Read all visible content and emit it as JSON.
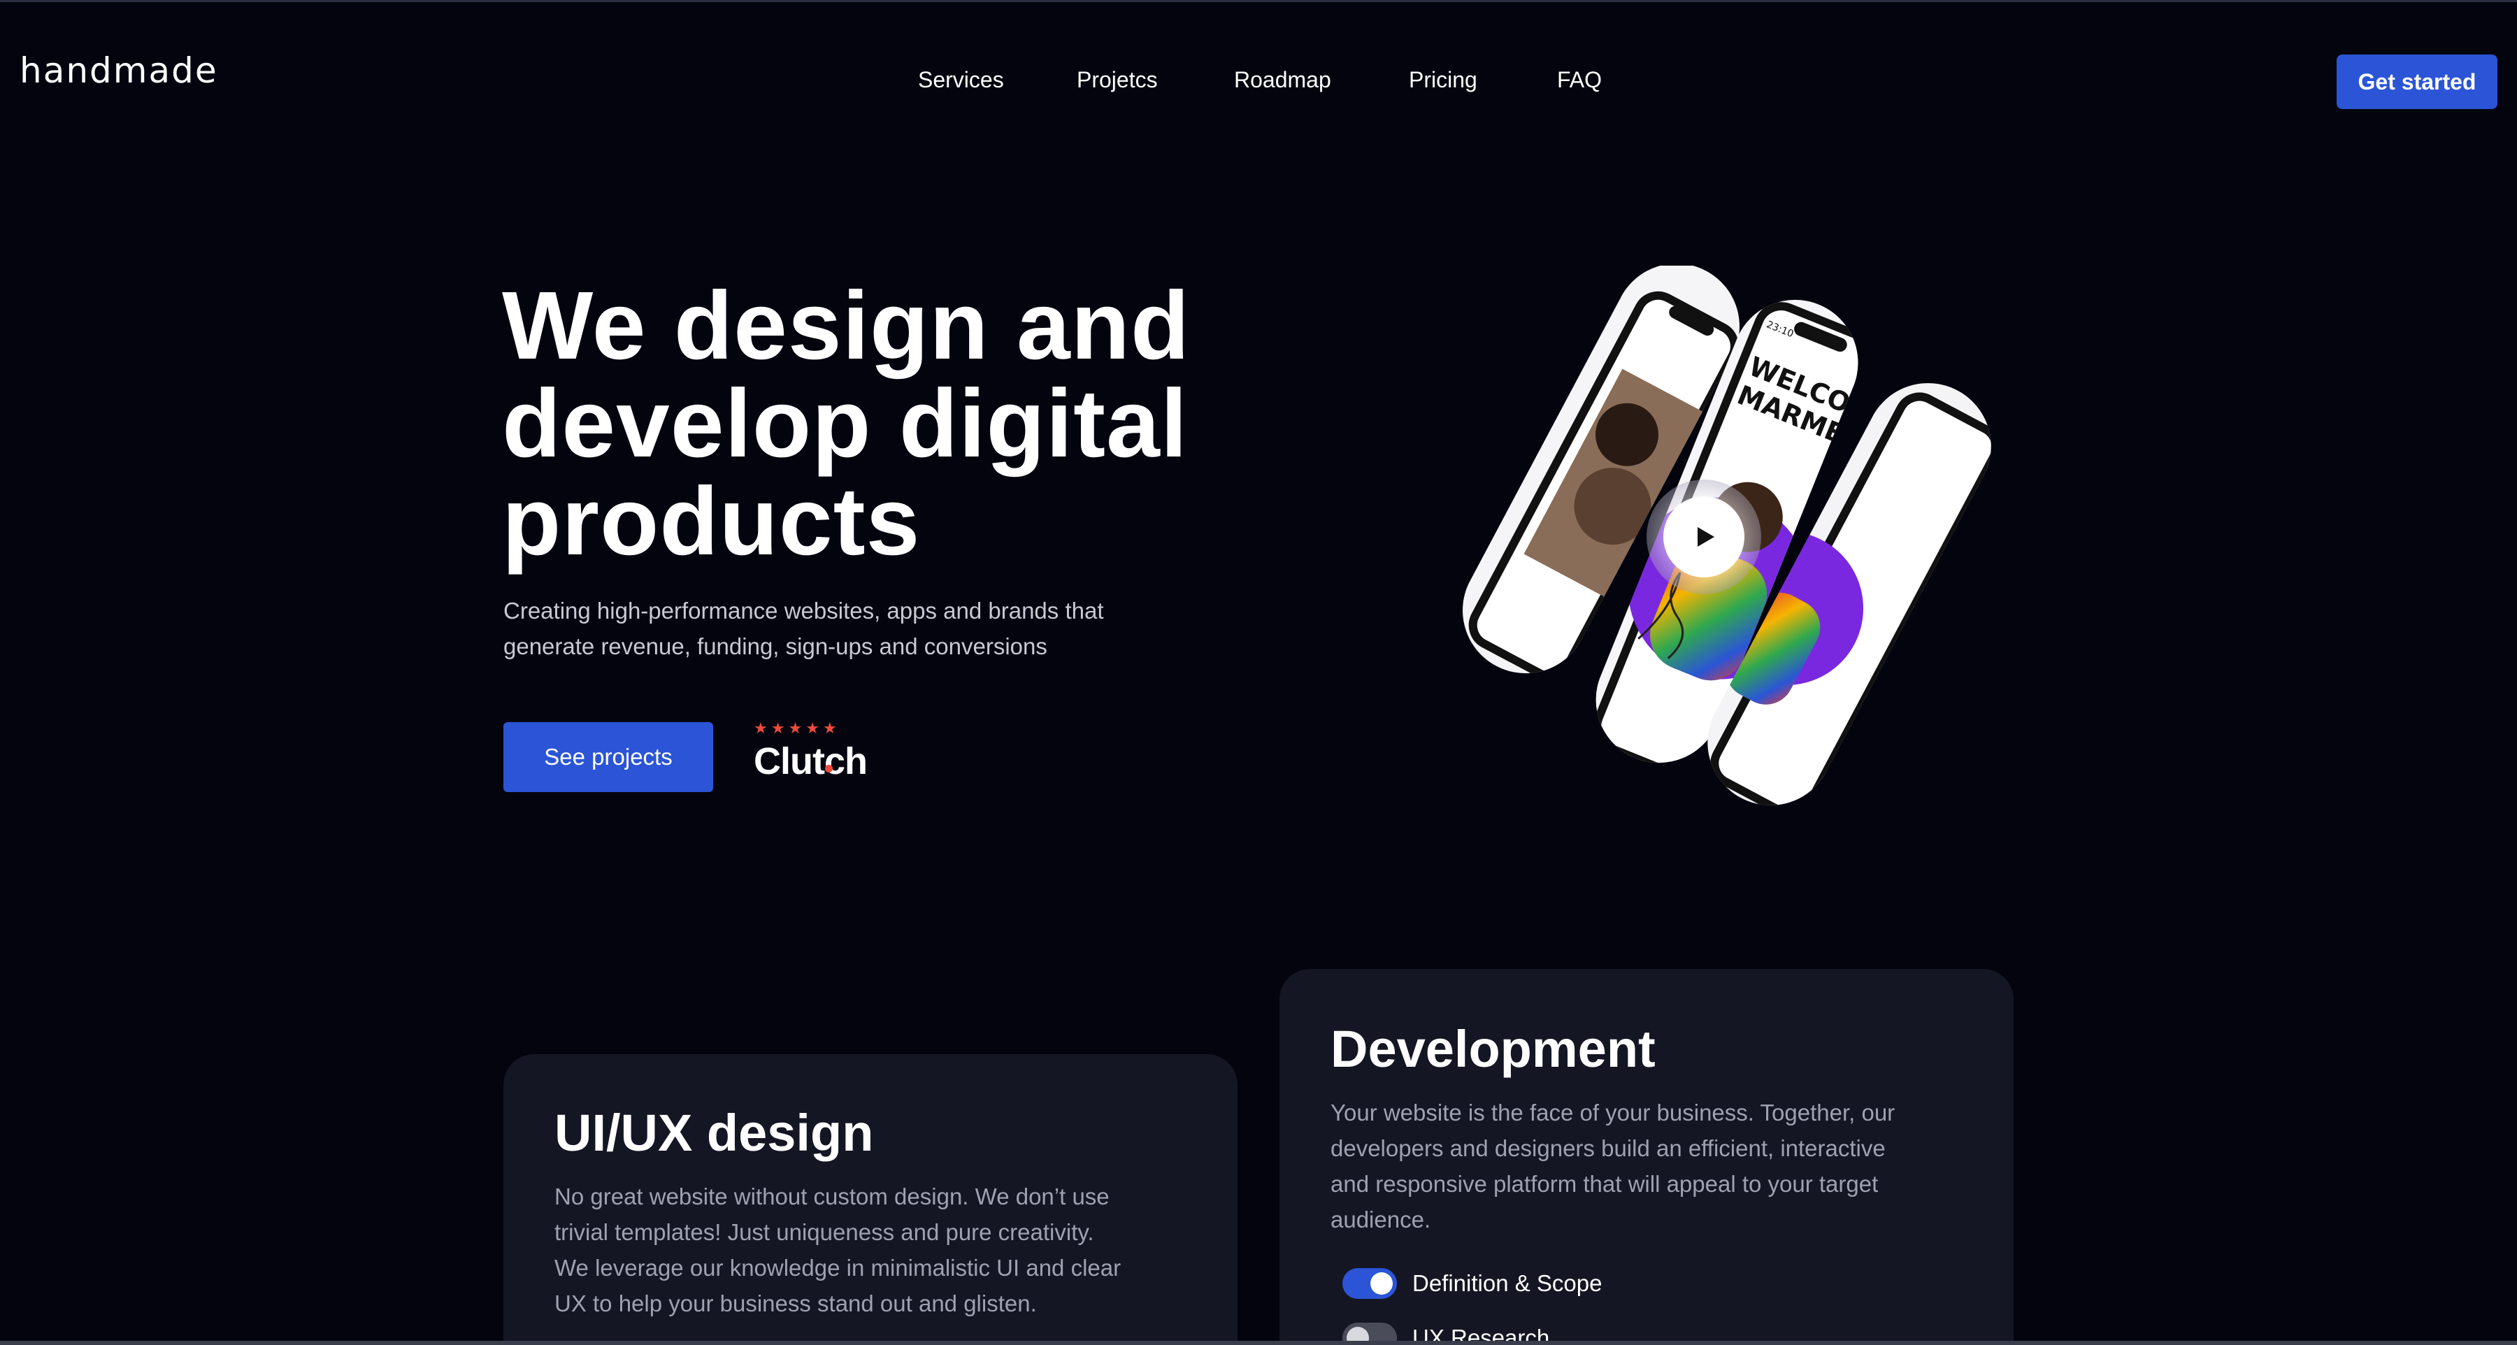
{
  "header": {
    "logo": "handmade",
    "nav": [
      "Services",
      "Projetcs",
      "Roadmap",
      "Pricing",
      "FAQ"
    ],
    "cta_label": "Get started"
  },
  "hero": {
    "title_lines": [
      "We design and",
      "develop digital",
      "products"
    ],
    "subtitle_lines": [
      "Creating high-performance websites, apps and brands that",
      "generate revenue, funding, sign-ups and conversions"
    ],
    "primary_button": "See projects",
    "rating": {
      "brand": "Clutch",
      "stars": 5
    },
    "phone_screen_lines": [
      "WELCOME",
      "MARMELO"
    ],
    "phone_clock": "23:10"
  },
  "cards": {
    "uiux": {
      "title": "UI/UX design",
      "text_lines": [
        "No great website without custom design. We don’t use",
        "trivial templates! Just uniqueness and pure creativity.",
        "We leverage our knowledge in minimalistic UI and clear",
        "UX to help your business stand out and glisten."
      ]
    },
    "development": {
      "title": "Development",
      "text_lines": [
        "Your website is the face of your business. Together, our",
        "developers and designers build an efficient, interactive",
        "and responsive platform that will appeal to your target",
        "audience."
      ],
      "options": [
        {
          "label": "Definition & Scope",
          "enabled": true
        },
        {
          "label": "UX Research",
          "enabled": false
        }
      ]
    }
  },
  "colors": {
    "background": "#04040f",
    "accent": "#2b55d6",
    "card": "#141623",
    "star": "#ef4a3b"
  }
}
